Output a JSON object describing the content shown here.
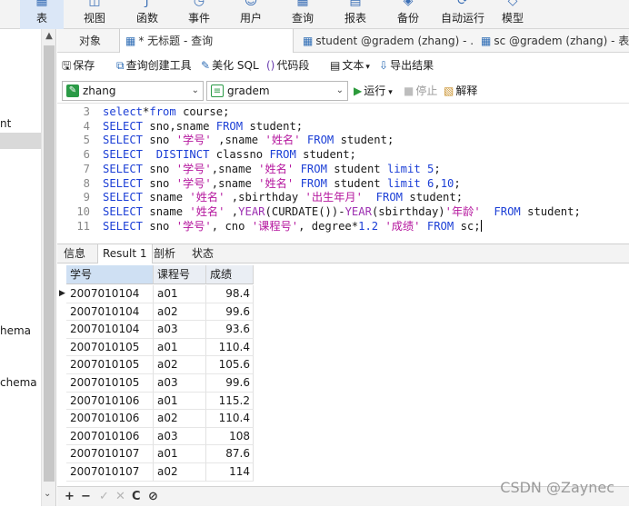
{
  "ribbon": [
    {
      "label": "表",
      "icon": "table-icon",
      "active": true
    },
    {
      "label": "视图",
      "icon": "view-icon",
      "active": false
    },
    {
      "label": "函数",
      "icon": "function-icon",
      "active": false
    },
    {
      "label": "事件",
      "icon": "event-icon",
      "active": false
    },
    {
      "label": "用户",
      "icon": "user-icon",
      "active": false
    },
    {
      "label": "查询",
      "icon": "query-icon",
      "active": false
    },
    {
      "label": "报表",
      "icon": "report-icon",
      "active": false
    },
    {
      "label": "备份",
      "icon": "backup-icon",
      "active": false
    },
    {
      "label": "自动运行",
      "icon": "autorun-icon",
      "active": false
    },
    {
      "label": "模型",
      "icon": "model-icon",
      "active": false
    }
  ],
  "sidebar": {
    "items": [
      "nt",
      "hema",
      "chema"
    ]
  },
  "tabs": [
    {
      "label": "对象",
      "active": false
    },
    {
      "label": "* 无标题 - 查询",
      "active": true
    },
    {
      "label": "student @gradem (zhang) - ...",
      "active": false
    },
    {
      "label": "sc @gradem (zhang) - 表",
      "active": false
    }
  ],
  "toolbar": {
    "save": "保存",
    "query_builder": "查询创建工具",
    "beautify": "美化 SQL",
    "snippet": "代码段",
    "text": "文本",
    "export": "导出结果"
  },
  "connection": {
    "name": "zhang",
    "database": "gradem",
    "run": "运行",
    "stop": "停止",
    "explain": "解释"
  },
  "editor": {
    "lines": [
      {
        "no": "3",
        "tokens": [
          [
            "kw",
            "select"
          ],
          [
            "plain",
            "*"
          ],
          [
            "kw",
            "from"
          ],
          [
            "plain",
            " course;"
          ]
        ]
      },
      {
        "no": "4",
        "tokens": [
          [
            "kw",
            "SELECT"
          ],
          [
            "plain",
            " sno,sname "
          ],
          [
            "kw",
            "FROM"
          ],
          [
            "plain",
            " student;"
          ]
        ]
      },
      {
        "no": "5",
        "tokens": [
          [
            "kw",
            "SELECT"
          ],
          [
            "plain",
            " sno "
          ],
          [
            "str",
            "'学号'"
          ],
          [
            "plain",
            " ,sname "
          ],
          [
            "str",
            "'姓名'"
          ],
          [
            "plain",
            " "
          ],
          [
            "kw",
            "FROM"
          ],
          [
            "plain",
            " student;"
          ]
        ]
      },
      {
        "no": "6",
        "tokens": [
          [
            "kw",
            "SELECT"
          ],
          [
            "plain",
            "  "
          ],
          [
            "kw",
            "DISTINCT"
          ],
          [
            "plain",
            " classno "
          ],
          [
            "kw",
            "FROM"
          ],
          [
            "plain",
            " student;"
          ]
        ]
      },
      {
        "no": "7",
        "tokens": [
          [
            "kw",
            "SELECT"
          ],
          [
            "plain",
            " sno "
          ],
          [
            "str",
            "'学号'"
          ],
          [
            "plain",
            ",sname "
          ],
          [
            "str",
            "'姓名'"
          ],
          [
            "plain",
            " "
          ],
          [
            "kw",
            "FROM"
          ],
          [
            "plain",
            " student "
          ],
          [
            "kw",
            "limit"
          ],
          [
            "plain",
            " "
          ],
          [
            "num",
            "5"
          ],
          [
            "plain",
            ";"
          ]
        ]
      },
      {
        "no": "8",
        "tokens": [
          [
            "kw",
            "SELECT"
          ],
          [
            "plain",
            " sno "
          ],
          [
            "str",
            "'学号'"
          ],
          [
            "plain",
            ",sname "
          ],
          [
            "str",
            "'姓名'"
          ],
          [
            "plain",
            " "
          ],
          [
            "kw",
            "FROM"
          ],
          [
            "plain",
            " student "
          ],
          [
            "kw",
            "limit"
          ],
          [
            "plain",
            " "
          ],
          [
            "num",
            "6"
          ],
          [
            "plain",
            ","
          ],
          [
            "num",
            "10"
          ],
          [
            "plain",
            ";"
          ]
        ]
      },
      {
        "no": "9",
        "tokens": [
          [
            "kw",
            "SELECT"
          ],
          [
            "plain",
            " sname "
          ],
          [
            "str",
            "'姓名'"
          ],
          [
            "plain",
            " ,sbirthday "
          ],
          [
            "str",
            "'出生年月'"
          ],
          [
            "plain",
            "  "
          ],
          [
            "kw",
            "FROM"
          ],
          [
            "plain",
            " student;"
          ]
        ]
      },
      {
        "no": "10",
        "tokens": [
          [
            "kw",
            "SELECT"
          ],
          [
            "plain",
            " sname "
          ],
          [
            "str",
            "'姓名'"
          ],
          [
            "plain",
            " ,"
          ],
          [
            "fn",
            "YEAR"
          ],
          [
            "plain",
            "(CURDATE())-"
          ],
          [
            "fn",
            "YEAR"
          ],
          [
            "plain",
            "(sbirthday)"
          ],
          [
            "str",
            "'年龄'"
          ],
          [
            "plain",
            "  "
          ],
          [
            "kw",
            "FROM"
          ],
          [
            "plain",
            " student;"
          ]
        ]
      },
      {
        "no": "11",
        "tokens": [
          [
            "kw",
            "SELECT"
          ],
          [
            "plain",
            " sno "
          ],
          [
            "str",
            "'学号'"
          ],
          [
            "plain",
            ", cno "
          ],
          [
            "str",
            "'课程号'"
          ],
          [
            "plain",
            ", degree*"
          ],
          [
            "num",
            "1.2"
          ],
          [
            "plain",
            " "
          ],
          [
            "str",
            "'成绩'"
          ],
          [
            "plain",
            " "
          ],
          [
            "kw",
            "FROM"
          ],
          [
            "plain",
            " sc;"
          ]
        ]
      }
    ]
  },
  "result_tabs": [
    {
      "label": "信息",
      "active": false
    },
    {
      "label": "Result 1",
      "active": true
    },
    {
      "label": "剖析",
      "active": false
    },
    {
      "label": "状态",
      "active": false
    }
  ],
  "grid": {
    "columns": [
      "学号",
      "课程号",
      "成绩"
    ],
    "rows": [
      [
        "2007010104",
        "a01",
        "98.4"
      ],
      [
        "2007010104",
        "a02",
        "99.6"
      ],
      [
        "2007010104",
        "a03",
        "93.6"
      ],
      [
        "2007010105",
        "a01",
        "110.4"
      ],
      [
        "2007010105",
        "a02",
        "105.6"
      ],
      [
        "2007010105",
        "a03",
        "99.6"
      ],
      [
        "2007010106",
        "a01",
        "115.2"
      ],
      [
        "2007010106",
        "a02",
        "110.4"
      ],
      [
        "2007010106",
        "a03",
        "108"
      ],
      [
        "2007010107",
        "a01",
        "87.6"
      ],
      [
        "2007010107",
        "a02",
        "114"
      ]
    ]
  },
  "bottom_bar": [
    {
      "glyph": "+",
      "name": "add-row-button",
      "dim": false
    },
    {
      "glyph": "−",
      "name": "delete-row-button",
      "dim": false
    },
    {
      "glyph": "✓",
      "name": "apply-changes-button",
      "dim": true
    },
    {
      "glyph": "✕",
      "name": "discard-changes-button",
      "dim": true
    },
    {
      "glyph": "C",
      "name": "refresh-button",
      "dim": false
    },
    {
      "glyph": "⊘",
      "name": "stop-button",
      "dim": false
    }
  ],
  "watermark": "CSDN @Zaynec"
}
